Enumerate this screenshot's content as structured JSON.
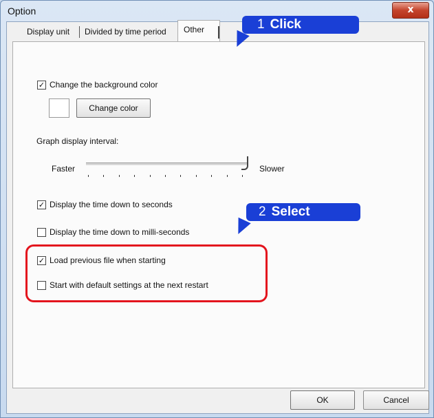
{
  "window": {
    "title": "Option",
    "close_glyph": "x"
  },
  "tabs": [
    {
      "label": "Display unit",
      "active": false
    },
    {
      "label": "Divided by time period",
      "active": false
    },
    {
      "label": "Other",
      "active": true
    }
  ],
  "options": {
    "change_bg": {
      "label": "Change the background color",
      "checked": true
    },
    "change_color_button": "Change color",
    "graph_interval": {
      "label": "Graph display interval:",
      "left_label": "Faster",
      "right_label": "Slower",
      "level": 1.0,
      "ticks": 11
    },
    "seconds": {
      "label": "Display the time down to seconds",
      "checked": true
    },
    "milliseconds": {
      "label": "Display the time down to milli-seconds",
      "checked": false
    },
    "load_previous": {
      "label": "Load previous file when starting",
      "checked": true
    },
    "default_settings": {
      "label": "Start with default settings at the next restart",
      "checked": false
    }
  },
  "footer": {
    "ok": "OK",
    "cancel": "Cancel"
  },
  "callouts": {
    "click": {
      "number": "1",
      "word": "Click"
    },
    "select": {
      "number": "2",
      "word": "Select"
    }
  },
  "colors": {
    "callout": "#1a3fd6",
    "highlight": "#e3141d"
  },
  "check_glyph": "✓"
}
